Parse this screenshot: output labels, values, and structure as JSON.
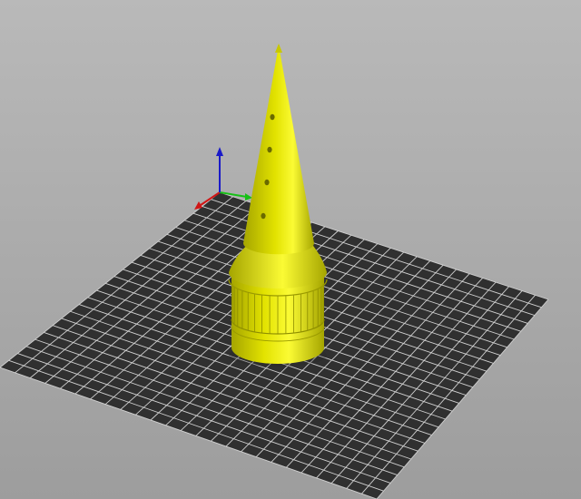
{
  "viewport": {
    "background_top": "#b9b9b9",
    "background_bottom": "#9d9d9d"
  },
  "build_plate": {
    "color": "#303030",
    "grid_color": "#d0d0d0",
    "grid_divisions": 25
  },
  "axes": {
    "x_color": "#d01515",
    "y_color": "#16c016",
    "z_color": "#1a1ac8"
  },
  "model": {
    "kind": "cone-with-knurled-base",
    "color": "#e2e200",
    "shade_dark": "#a5a500",
    "shade_light": "#fbfb34",
    "hole_count": 4
  }
}
